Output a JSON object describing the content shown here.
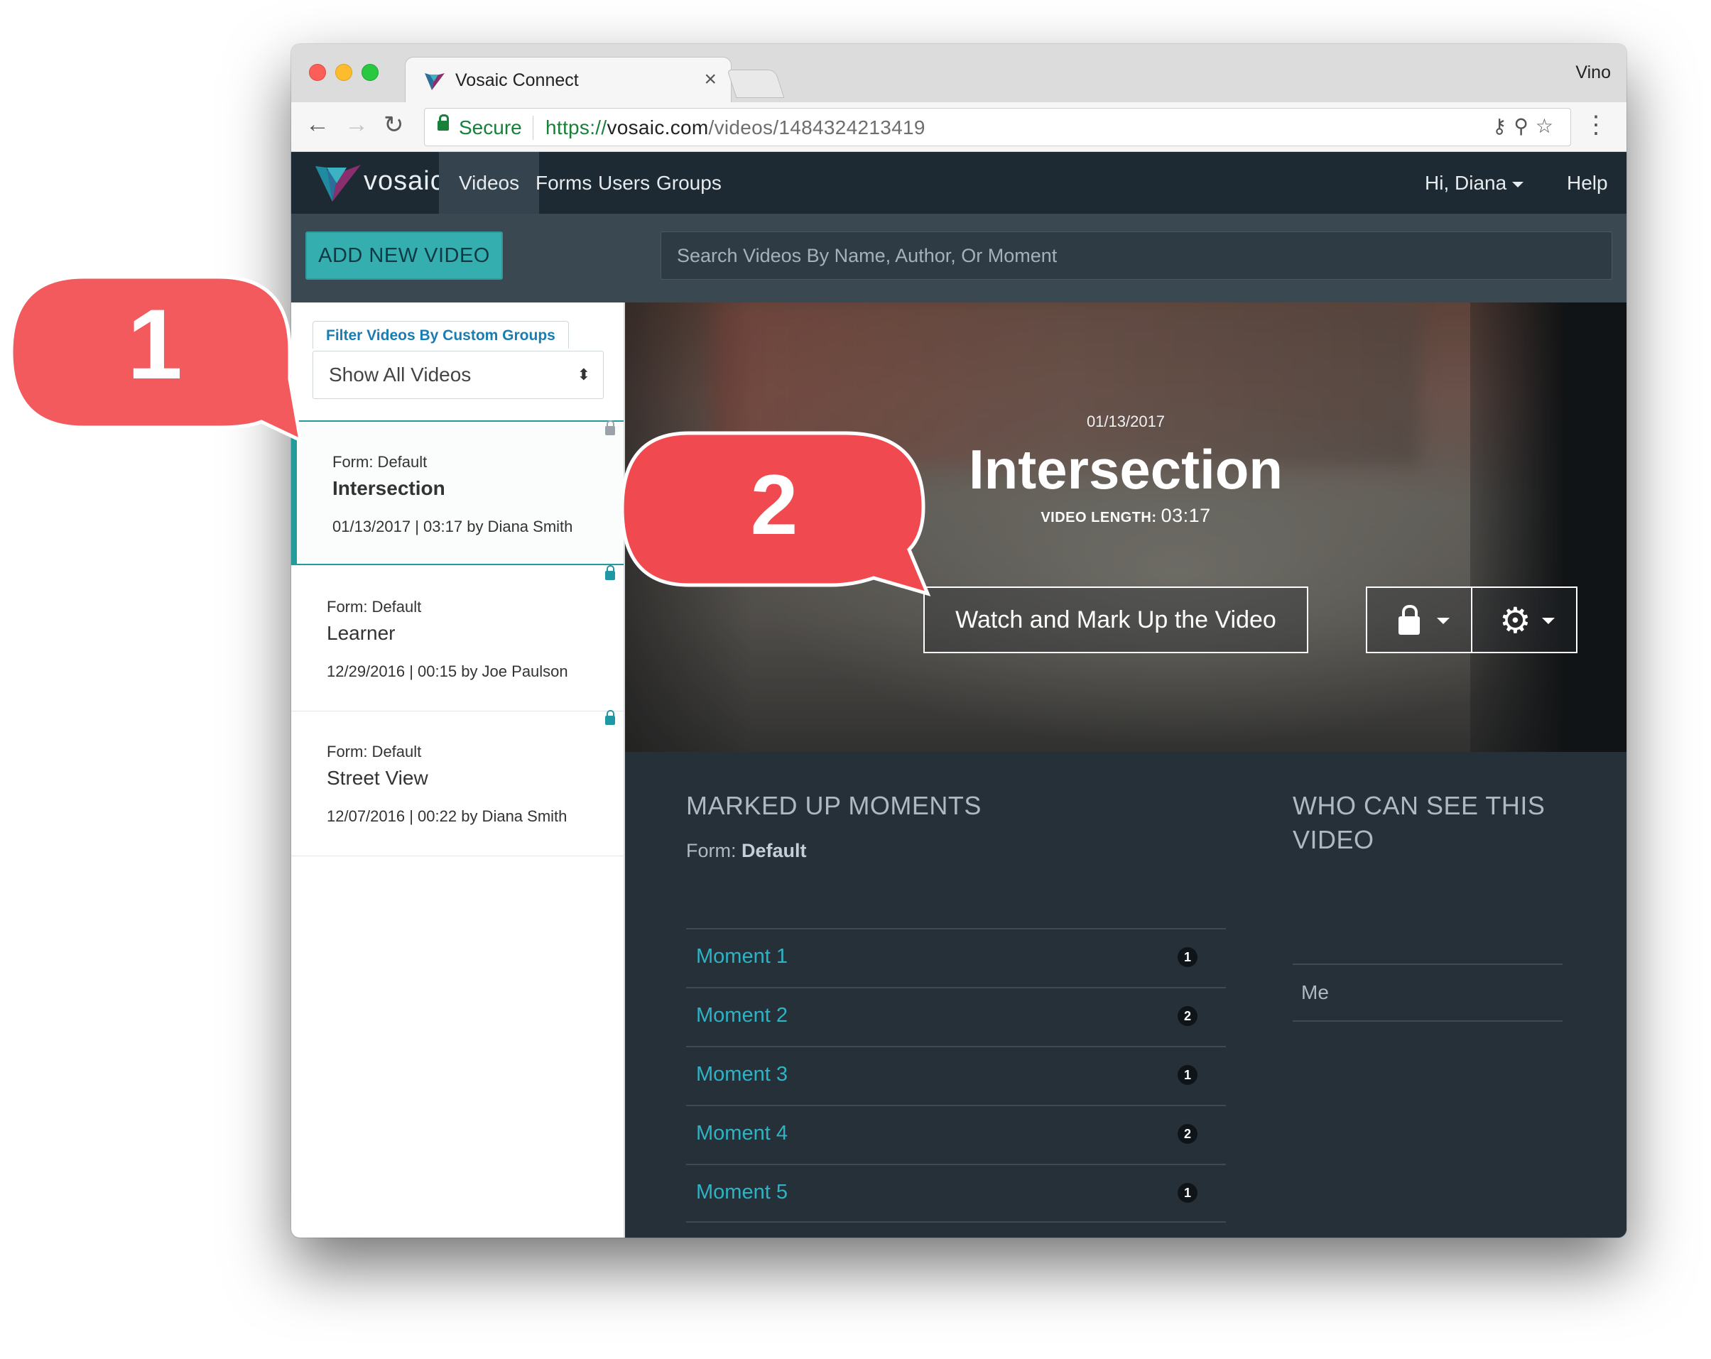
{
  "browser": {
    "tab_title": "Vosaic Connect",
    "tab_close": "×",
    "profile_name": "Vino",
    "secure_label": "Secure",
    "url_scheme": "https://",
    "url_host": "vosaic.com",
    "url_path": "/videos/1484324213419"
  },
  "nav": {
    "logo_text": "vosaic",
    "items": [
      "Videos",
      "Forms",
      "Users",
      "Groups"
    ],
    "user_menu": "Hi, Diana",
    "help": "Help"
  },
  "toolbar": {
    "add_video_label": "ADD NEW VIDEO",
    "search_placeholder": "Search Videos By Name, Author, Or Moment"
  },
  "sidebar": {
    "filter_label": "Filter Videos By Custom Groups",
    "filter_value": "Show All Videos",
    "videos": [
      {
        "form": "Form: Default",
        "title": "Intersection",
        "meta": "01/13/2017 | 03:17 by Diana Smith",
        "lock": "locked",
        "selected": true
      },
      {
        "form": "Form: Default",
        "title": "Learner",
        "meta": "12/29/2016 | 00:15 by Joe Paulson",
        "lock": "unlocked",
        "selected": false
      },
      {
        "form": "Form: Default",
        "title": "Street View",
        "meta": "12/07/2016 | 00:22 by Diana Smith",
        "lock": "unlocked",
        "selected": false
      }
    ]
  },
  "video": {
    "date": "01/13/2017",
    "title": "Intersection",
    "length_label": "VIDEO LENGTH:",
    "length_value": "03:17",
    "watch_button": "Watch and Mark Up the Video"
  },
  "moments_section": {
    "heading": "MARKED UP MOMENTS",
    "form_prefix": "Form:",
    "form_name": "Default",
    "moments": [
      {
        "label": "Moment 1",
        "count": "1"
      },
      {
        "label": "Moment 2",
        "count": "2"
      },
      {
        "label": "Moment 3",
        "count": "1"
      },
      {
        "label": "Moment 4",
        "count": "2"
      },
      {
        "label": "Moment 5",
        "count": "1"
      }
    ]
  },
  "visibility_section": {
    "heading_line1": "WHO CAN SEE THIS",
    "heading_line2": "VIDEO",
    "viewers": [
      "Me"
    ]
  },
  "callouts": {
    "one": "1",
    "two": "2"
  },
  "colors": {
    "accent_teal": "#35aeb0",
    "callout_red": "#f25a5e",
    "nav_bg": "#1d2933",
    "link": "#2fb3c4"
  }
}
